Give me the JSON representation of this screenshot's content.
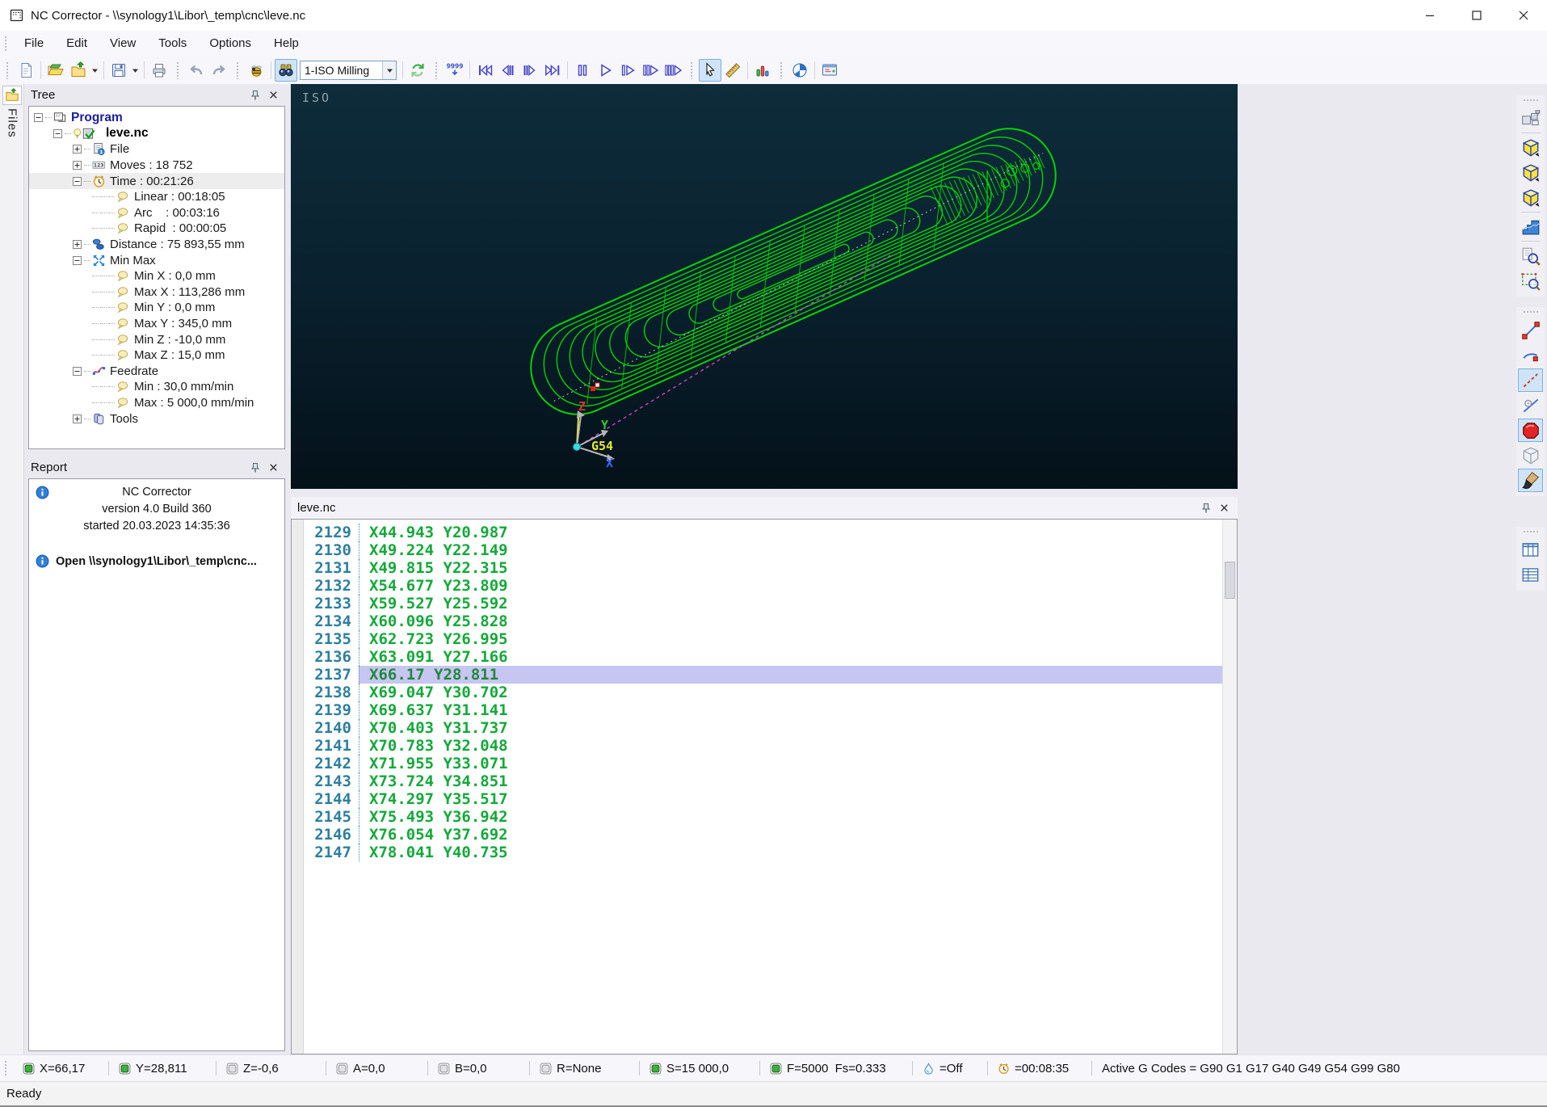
{
  "window": {
    "title": "NC Corrector - \\\\synology1\\Libor\\_temp\\cnc\\leve.nc"
  },
  "menu": {
    "items": [
      "File",
      "Edit",
      "View",
      "Tools",
      "Options",
      "Help"
    ]
  },
  "toolbar": {
    "combo_value": "1-ISO Milling",
    "goto_digits": "9999",
    "items": [
      {
        "t": "grip"
      },
      {
        "t": "btn",
        "n": "new-file"
      },
      {
        "t": "sep"
      },
      {
        "t": "btn",
        "n": "open-file"
      },
      {
        "t": "btn",
        "n": "open-recent"
      },
      {
        "t": "dd",
        "n": "open-recent-dropdown"
      },
      {
        "t": "sep"
      },
      {
        "t": "btn",
        "n": "save-file"
      },
      {
        "t": "dd",
        "n": "save-dropdown"
      },
      {
        "t": "sep"
      },
      {
        "t": "btn",
        "n": "print"
      },
      {
        "t": "grip"
      },
      {
        "t": "btn",
        "n": "undo"
      },
      {
        "t": "btn",
        "n": "redo"
      },
      {
        "t": "grip"
      },
      {
        "t": "btn",
        "n": "debug"
      },
      {
        "t": "sep"
      },
      {
        "t": "btn",
        "n": "find",
        "pressed": true
      },
      {
        "t": "combo",
        "n": "interpreter-combo"
      },
      {
        "t": "sep"
      },
      {
        "t": "btn",
        "n": "reload"
      },
      {
        "t": "grip"
      },
      {
        "t": "btn",
        "n": "goto-line"
      },
      {
        "t": "sep"
      },
      {
        "t": "btn",
        "n": "rewind-start"
      },
      {
        "t": "btn",
        "n": "step-back"
      },
      {
        "t": "btn",
        "n": "step-forward"
      },
      {
        "t": "btn",
        "n": "fast-forward"
      },
      {
        "t": "sep"
      },
      {
        "t": "btn",
        "n": "pause"
      },
      {
        "t": "btn",
        "n": "play"
      },
      {
        "t": "btn",
        "n": "play-to-breakpoint"
      },
      {
        "t": "btn",
        "n": "play-fast"
      },
      {
        "t": "btn",
        "n": "play-faster"
      },
      {
        "t": "grip"
      },
      {
        "t": "btn",
        "n": "select-cursor",
        "pressed": true
      },
      {
        "t": "btn",
        "n": "measure"
      },
      {
        "t": "sep"
      },
      {
        "t": "btn",
        "n": "statistics"
      },
      {
        "t": "grip"
      },
      {
        "t": "btn",
        "n": "pie-analysis"
      },
      {
        "t": "sep"
      },
      {
        "t": "btn",
        "n": "settings-screen"
      }
    ]
  },
  "files_tab": {
    "label": "Files"
  },
  "tree_panel": {
    "title": "Tree",
    "rows": [
      {
        "level": 0,
        "exp": "minus",
        "icon": "program",
        "label": "Program",
        "style": "program"
      },
      {
        "level": 1,
        "exp": "minus",
        "icon": "nc",
        "label": "leve.nc",
        "style": "file"
      },
      {
        "level": 2,
        "exp": "plus",
        "icon": "file",
        "label": "File"
      },
      {
        "level": 2,
        "exp": "plus",
        "icon": "moves",
        "label": "Moves : 18 752"
      },
      {
        "level": 2,
        "exp": "minus",
        "icon": "clock",
        "label": "Time : 00:21:26",
        "selected": true
      },
      {
        "level": 3,
        "icon": "bubble",
        "label": "Linear : 00:18:05"
      },
      {
        "level": 3,
        "icon": "bubble",
        "label": "Arc    : 00:03:16"
      },
      {
        "level": 3,
        "icon": "bubble",
        "label": "Rapid  : 00:00:05"
      },
      {
        "level": 2,
        "exp": "plus",
        "icon": "distance",
        "label": "Distance : 75 893,55 mm"
      },
      {
        "level": 2,
        "exp": "minus",
        "icon": "minmax",
        "label": "Min Max"
      },
      {
        "level": 3,
        "icon": "bubble",
        "label": "Min X : 0,0 mm"
      },
      {
        "level": 3,
        "icon": "bubble",
        "label": "Max X : 113,286 mm"
      },
      {
        "level": 3,
        "icon": "bubble",
        "label": "Min Y : 0,0 mm"
      },
      {
        "level": 3,
        "icon": "bubble",
        "label": "Max Y : 345,0 mm"
      },
      {
        "level": 3,
        "icon": "bubble",
        "label": "Min Z : -10,0 mm"
      },
      {
        "level": 3,
        "icon": "bubble",
        "label": "Max Z : 15,0 mm"
      },
      {
        "level": 2,
        "exp": "minus",
        "icon": "feedrate",
        "label": "Feedrate"
      },
      {
        "level": 3,
        "icon": "bubble",
        "label": "Min : 30,0 mm/min"
      },
      {
        "level": 3,
        "icon": "bubble",
        "label": "Max : 5 000,0 mm/min"
      },
      {
        "level": 2,
        "exp": "plus",
        "icon": "tools",
        "label": "Tools"
      }
    ]
  },
  "report_panel": {
    "title": "Report",
    "info_lines": [
      "NC Corrector",
      "version 4.0 Build 360",
      "started 20.03.2023 14:35:36"
    ],
    "open_message": "Open \\\\synology1\\Libor\\_temp\\cnc..."
  },
  "viewport": {
    "view_label": "ISO",
    "axis": {
      "x_label": "X",
      "y_label": "Y",
      "z_label": "Z",
      "wcs_label": "G54"
    }
  },
  "code_panel": {
    "title": "leve.nc",
    "highlighted_line": "2137",
    "lines": [
      {
        "n": "2129",
        "t": "X44.943 Y20.987"
      },
      {
        "n": "2130",
        "t": "X49.224 Y22.149"
      },
      {
        "n": "2131",
        "t": "X49.815 Y22.315"
      },
      {
        "n": "2132",
        "t": "X54.677 Y23.809"
      },
      {
        "n": "2133",
        "t": "X59.527 Y25.592"
      },
      {
        "n": "2134",
        "t": "X60.096 Y25.828"
      },
      {
        "n": "2135",
        "t": "X62.723 Y26.995"
      },
      {
        "n": "2136",
        "t": "X63.091 Y27.166"
      },
      {
        "n": "2137",
        "t": "X66.17 Y28.811",
        "hl": true
      },
      {
        "n": "2138",
        "t": "X69.047 Y30.702"
      },
      {
        "n": "2139",
        "t": "X69.637 Y31.141"
      },
      {
        "n": "2140",
        "t": "X70.403 Y31.737"
      },
      {
        "n": "2141",
        "t": "X70.783 Y32.048"
      },
      {
        "n": "2142",
        "t": "X71.955 Y33.071"
      },
      {
        "n": "2143",
        "t": "X73.724 Y34.851"
      },
      {
        "n": "2144",
        "t": "X74.297 Y35.517"
      },
      {
        "n": "2145",
        "t": "X75.493 Y36.942"
      },
      {
        "n": "2146",
        "t": "X76.054 Y37.692"
      },
      {
        "n": "2147",
        "t": "X78.041 Y40.735"
      }
    ]
  },
  "right_toolbar": {
    "groups": [
      {
        "id": "g1",
        "items": [
          {
            "n": "machine-view"
          },
          {
            "sep": true
          },
          {
            "n": "iso-view-1"
          },
          {
            "n": "iso-view-2"
          },
          {
            "n": "iso-view-3"
          },
          {
            "sep": true
          },
          {
            "n": "stairs-view"
          },
          {
            "sep": true
          },
          {
            "n": "zoom-fit"
          },
          {
            "n": "zoom-window"
          }
        ]
      },
      {
        "id": "g2",
        "items": [
          {
            "n": "line-tool"
          },
          {
            "n": "arc-tool"
          },
          {
            "n": "dashed-line-tool",
            "pressed": true
          },
          {
            "n": "tangent-tool"
          },
          {
            "n": "spot-tool",
            "pressed": true
          },
          {
            "n": "solid-tool"
          },
          {
            "n": "brush-tool",
            "pressed": true
          }
        ]
      },
      {
        "id": "g3",
        "items": [
          {
            "n": "code-table-1"
          },
          {
            "n": "code-table-2"
          }
        ]
      }
    ]
  },
  "statusbar": {
    "ready": "Ready",
    "items": [
      {
        "led": "on",
        "label": "X=66,17"
      },
      {
        "led": "on",
        "label": "Y=28,811"
      },
      {
        "led": "off",
        "label": "Z=-0,6"
      },
      {
        "led": "off",
        "label": "A=0,0"
      },
      {
        "led": "off",
        "label": "B=0,0"
      },
      {
        "led": "off",
        "label": "R=None"
      },
      {
        "led": "on",
        "label": "S=15 000,0"
      },
      {
        "led": "on",
        "label": "F=5000  Fs=0.333"
      },
      {
        "icon": "coolant-drop",
        "label": "=Off"
      },
      {
        "icon": "timer-clock",
        "label": "=00:08:35"
      },
      {
        "label": "Active G Codes = G90 G1 G17 G40 G49 G54 G99 G80"
      }
    ]
  }
}
